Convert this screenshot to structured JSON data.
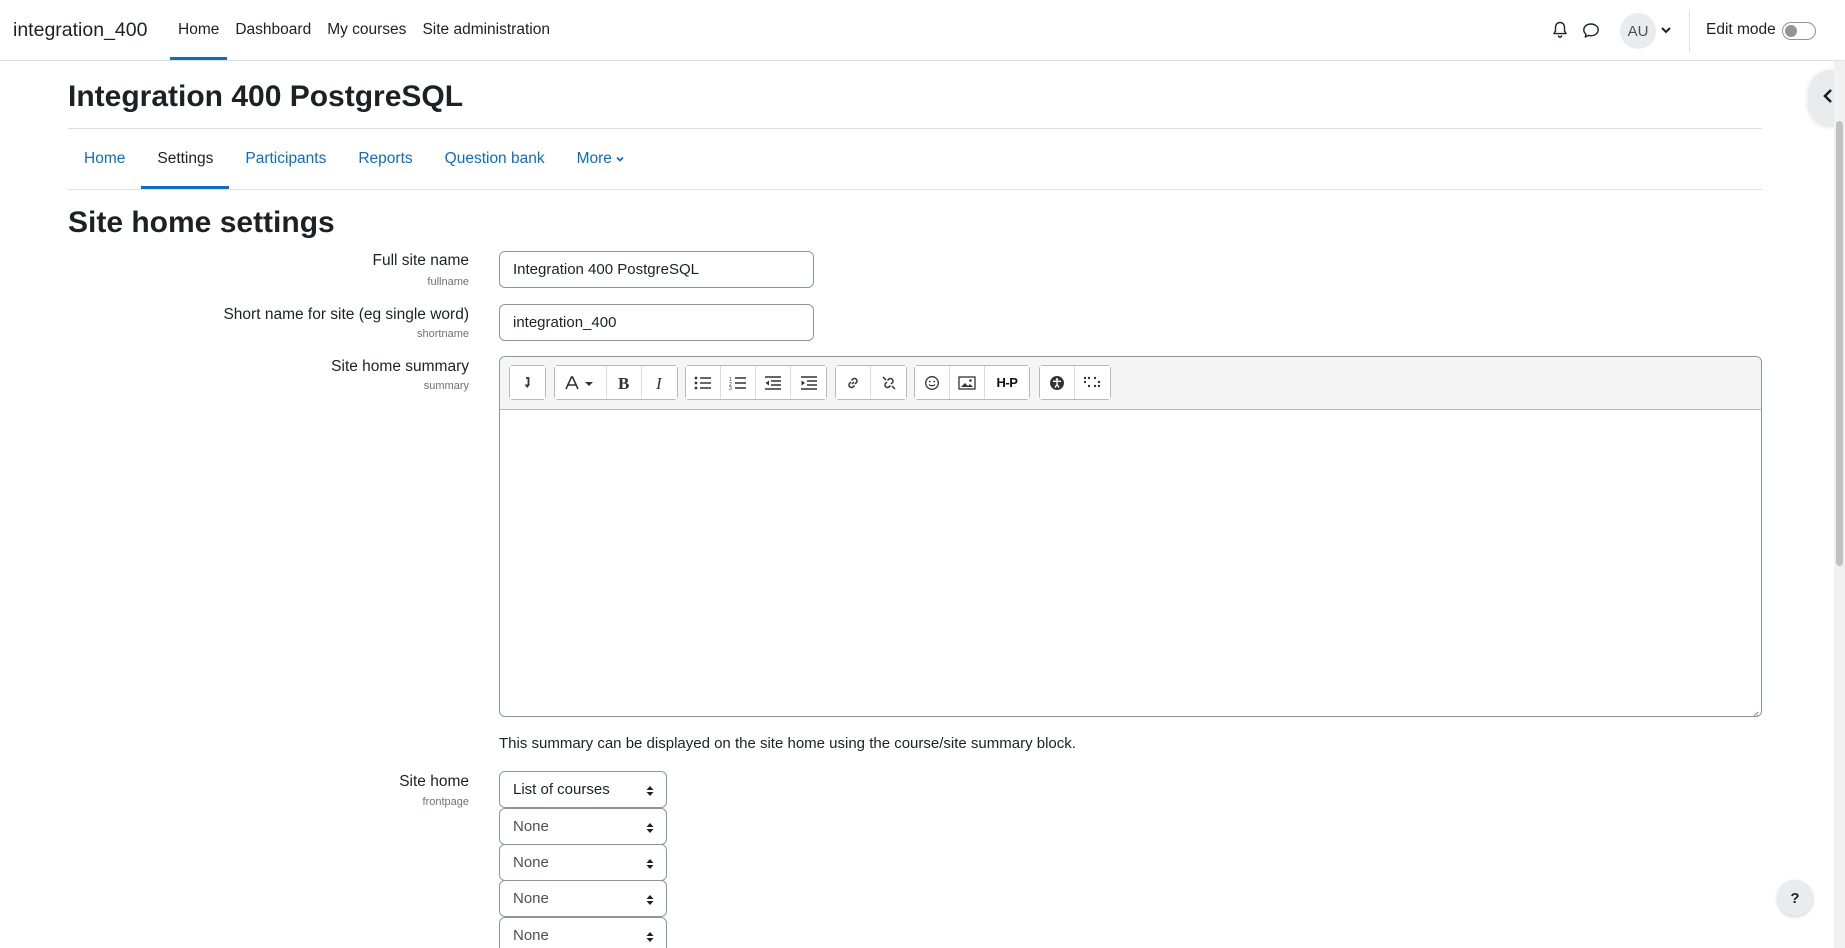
{
  "navbar": {
    "brand": "integration_400",
    "items": [
      {
        "label": "Home",
        "active": true
      },
      {
        "label": "Dashboard",
        "active": false
      },
      {
        "label": "My courses",
        "active": false
      },
      {
        "label": "Site administration",
        "active": false
      }
    ],
    "avatar_initials": "AU",
    "edit_mode_label": "Edit mode",
    "edit_mode_on": false,
    "icons": [
      "bell-icon",
      "chat-icon",
      "chevron-down-icon"
    ]
  },
  "page": {
    "title": "Integration 400 PostgreSQL",
    "secondary_nav": [
      {
        "label": "Home",
        "active": false
      },
      {
        "label": "Settings",
        "active": true
      },
      {
        "label": "Participants",
        "active": false
      },
      {
        "label": "Reports",
        "active": false
      },
      {
        "label": "Question bank",
        "active": false
      },
      {
        "label": "More",
        "active": false
      }
    ],
    "section_title": "Site home settings"
  },
  "form": {
    "fullname": {
      "label": "Full site name",
      "sublabel": "fullname",
      "value": "Integration 400 PostgreSQL"
    },
    "shortname": {
      "label": "Short name for site (eg single word)",
      "sublabel": "shortname",
      "value": "integration_400"
    },
    "summary": {
      "label": "Site home summary",
      "sublabel": "summary",
      "value": "",
      "help": "This summary can be displayed on the site home using the course/site summary block."
    },
    "frontpage": {
      "label": "Site home",
      "sublabel": "frontpage",
      "selects": [
        "List of courses",
        "None",
        "None",
        "None",
        "None"
      ]
    }
  },
  "editor_toolbar": {
    "icons": [
      "collapse-icon",
      "font-style-icon",
      "bold-icon",
      "italic-icon",
      "unordered-list-icon",
      "ordered-list-icon",
      "outdent-icon",
      "indent-icon",
      "link-icon",
      "unlink-icon",
      "emoji-icon",
      "image-icon",
      "h5p-icon",
      "accessibility-checker-icon",
      "screenreader-helper-icon"
    ],
    "h5p_text": "H-P"
  },
  "help_button": "?",
  "colors": {
    "link": "#0f6cbf",
    "text": "#1d2125",
    "border": "#8f959e"
  }
}
